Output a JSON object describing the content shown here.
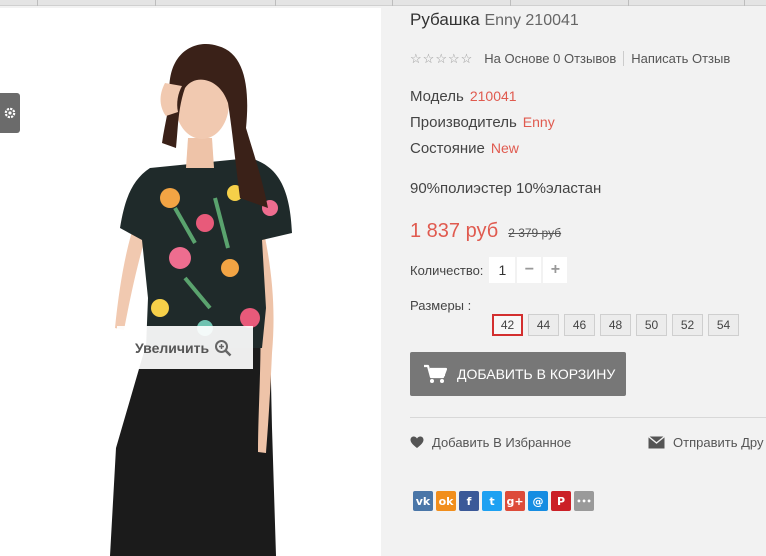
{
  "product": {
    "name": "Рубашка",
    "sub": "Enny 210041"
  },
  "rating": {
    "stars_filled": 0,
    "stars_total": 5,
    "reviews_text": "На Основе 0 Отзывов",
    "write_review": "Написать Отзыв"
  },
  "specs": [
    {
      "label": "Модель",
      "value": "210041"
    },
    {
      "label": "Производитель",
      "value": "Enny"
    },
    {
      "label": "Состояние",
      "value": "New"
    }
  ],
  "composition": "90%полиэстер 10%эластан",
  "price": {
    "current": "1 837 руб",
    "old": "2 379 руб"
  },
  "quantity": {
    "label": "Количество:",
    "value": "1",
    "minus": "−",
    "plus": "+"
  },
  "sizes": {
    "label": "Размеры :",
    "options": [
      "42",
      "44",
      "46",
      "48",
      "50",
      "52",
      "54"
    ],
    "selected": "42"
  },
  "actions": {
    "add_to_cart": "ДОБАВИТЬ В КОРЗИНУ",
    "wishlist": "Добавить В Избранное",
    "send_friend": "Отправить Дру"
  },
  "image": {
    "zoom_label": "Увеличить"
  },
  "colors": {
    "accent": "#e05a4f",
    "button": "#777777",
    "size_selected_border": "#d32f2f"
  },
  "social": [
    {
      "icon": "vk-icon",
      "glyph": "vk",
      "color": "#4a76a8"
    },
    {
      "icon": "odnoklassniki-icon",
      "glyph": "ok",
      "color": "#f18e1c"
    },
    {
      "icon": "facebook-icon",
      "glyph": "f",
      "color": "#3b5998"
    },
    {
      "icon": "twitter-icon",
      "glyph": "t",
      "color": "#1da1f2"
    },
    {
      "icon": "google-plus-icon",
      "glyph": "g+",
      "color": "#dd4b39"
    },
    {
      "icon": "mail-icon",
      "glyph": "@",
      "color": "#168de2"
    },
    {
      "icon": "pinterest-icon",
      "glyph": "P",
      "color": "#cb2027"
    },
    {
      "icon": "more-icon",
      "glyph": "•••",
      "color": "#9a9a9a"
    }
  ]
}
